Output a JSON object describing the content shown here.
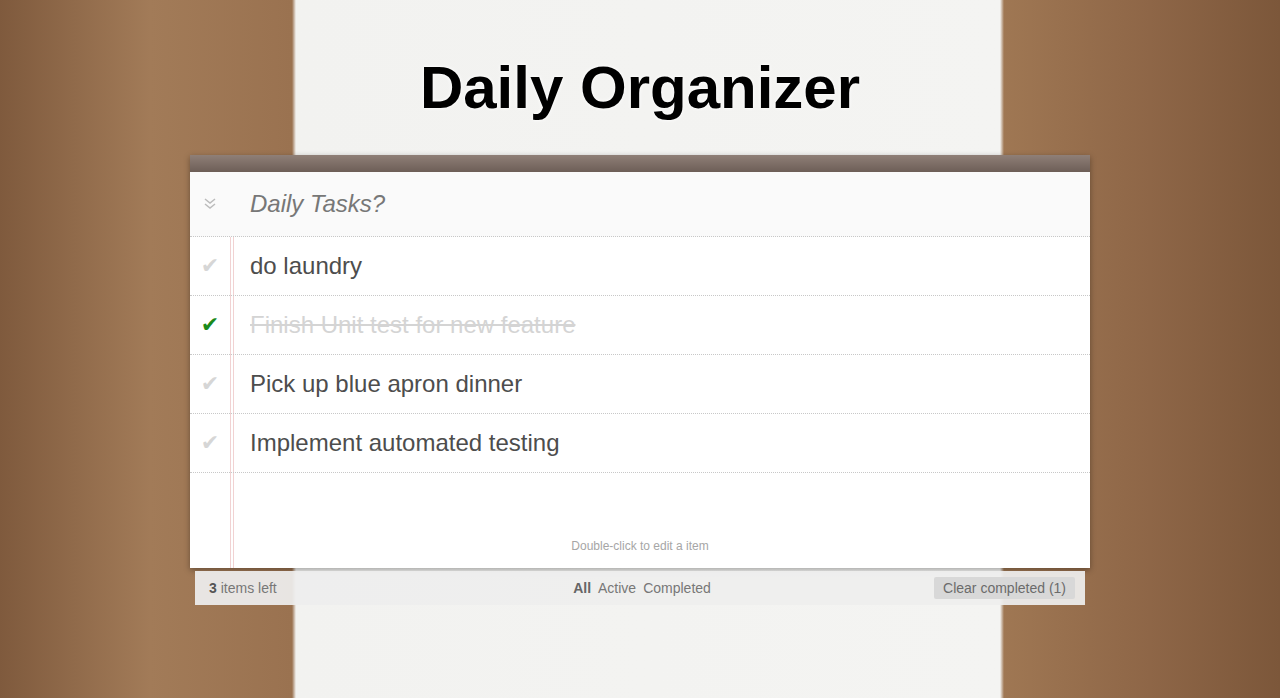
{
  "title": "Daily Organizer",
  "new_todo": {
    "placeholder": "Daily Tasks?"
  },
  "todos": [
    {
      "text": "do laundry",
      "check": "✔",
      "completed": false
    },
    {
      "text": "Finish Unit test for new feature",
      "check": "✔",
      "completed": true
    },
    {
      "text": "Pick up blue apron dinner",
      "check": "✔",
      "completed": false
    },
    {
      "text": "Implement automated testing",
      "check": "✔",
      "completed": false
    }
  ],
  "hint": "Double-click to edit a item",
  "footer": {
    "count": "3",
    "count_label": "items left",
    "filters": [
      {
        "label": "All",
        "selected": true
      },
      {
        "label": "Active",
        "selected": false
      },
      {
        "label": "Completed",
        "selected": false
      }
    ],
    "clear_button": "Clear completed (1)"
  }
}
